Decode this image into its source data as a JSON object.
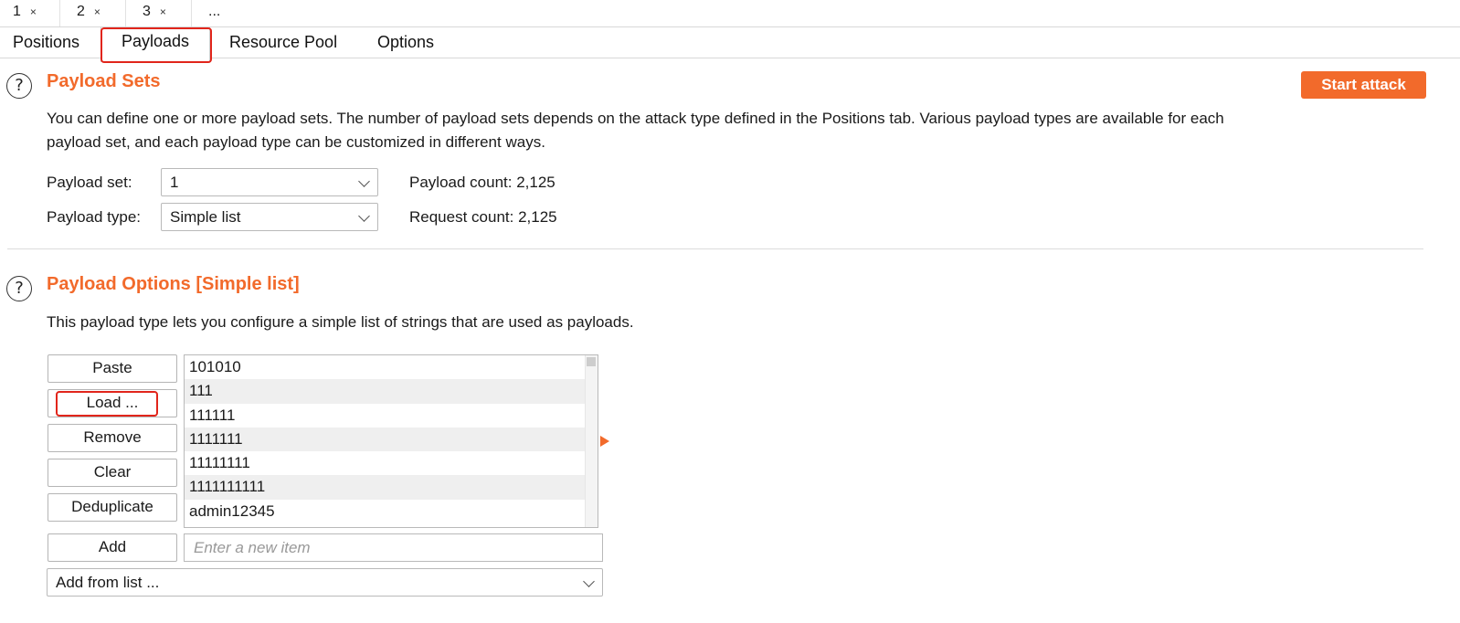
{
  "request_tabs": [
    {
      "label": "1",
      "close": "×"
    },
    {
      "label": "2",
      "close": "×"
    },
    {
      "label": "3",
      "close": "×"
    },
    {
      "label": "..."
    }
  ],
  "sub_tabs": [
    "Positions",
    "Payloads",
    "Resource Pool",
    "Options"
  ],
  "active_sub_tab": "Payloads",
  "help_icon": "?",
  "payload_sets": {
    "title": "Payload Sets",
    "description_line1": "You can define one or more payload sets. The number of payload sets depends on the attack type defined in the Positions tab. Various payload types are available for each",
    "description_line2": "payload set, and each payload type can be customized in different ways.",
    "start_attack": "Start attack",
    "set_label": "Payload set:",
    "set_value": "1",
    "type_label": "Payload type:",
    "type_value": "Simple list",
    "payload_count": "Payload count: 2,125",
    "request_count": "Request count: 2,125"
  },
  "payload_options": {
    "title": "Payload Options [Simple list]",
    "description": "This payload type lets you configure a simple list of strings that are used as payloads.",
    "buttons": {
      "paste": "Paste",
      "load": "Load ...",
      "remove": "Remove",
      "clear": "Clear",
      "deduplicate": "Deduplicate",
      "add": "Add"
    },
    "items": [
      "101010",
      "111",
      "111111",
      "1111111",
      "11111111",
      "1111111111",
      "admin12345"
    ],
    "new_item_placeholder": "Enter a new item",
    "add_from_list": "Add from list ..."
  },
  "colors": {
    "accent": "#f26a2b",
    "highlight": "#e1251b"
  }
}
